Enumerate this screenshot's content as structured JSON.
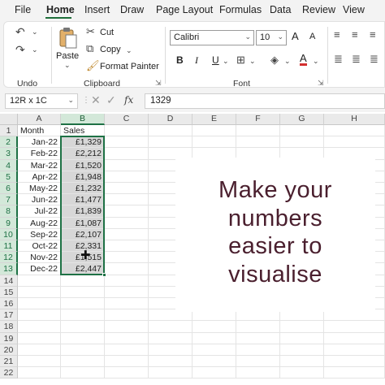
{
  "menu": {
    "items": [
      "File",
      "Home",
      "Insert",
      "Draw",
      "Page Layout",
      "Formulas",
      "Data",
      "Review",
      "View"
    ],
    "active": "Home"
  },
  "ribbon": {
    "undo_group_label": "Undo",
    "clipboard": {
      "paste_label": "Paste",
      "cut_label": "Cut",
      "copy_label": "Copy",
      "format_painter_label": "Format Painter",
      "group_label": "Clipboard"
    },
    "font": {
      "name": "Calibri",
      "size": "10",
      "group_label": "Font",
      "bold": "B",
      "italic": "I",
      "underline": "U",
      "grow": "A",
      "shrink": "A",
      "font_color_glyph": "A"
    }
  },
  "formula_bar": {
    "name_box": "12R x 1C",
    "fx": "fx",
    "value": "1329"
  },
  "grid": {
    "columns": [
      "A",
      "B",
      "C",
      "D",
      "E",
      "F",
      "G",
      "H"
    ],
    "rows": [
      "1",
      "2",
      "3",
      "4",
      "5",
      "6",
      "7",
      "8",
      "9",
      "10",
      "11",
      "12",
      "13",
      "14",
      "15",
      "16",
      "17",
      "18",
      "19",
      "20",
      "21",
      "22"
    ],
    "header": [
      "Month",
      "Sales"
    ],
    "data": [
      [
        "Jan-22",
        "£1,329"
      ],
      [
        "Feb-22",
        "£2,212"
      ],
      [
        "Mar-22",
        "£1,520"
      ],
      [
        "Apr-22",
        "£1,948"
      ],
      [
        "May-22",
        "£1,232"
      ],
      [
        "Jun-22",
        "£1,477"
      ],
      [
        "Jul-22",
        "£1,839"
      ],
      [
        "Aug-22",
        "£1,087"
      ],
      [
        "Sep-22",
        "£2,107"
      ],
      [
        "Oct-22",
        "£2,331"
      ],
      [
        "Nov-22",
        "£1,515"
      ],
      [
        "Dec-22",
        "£2,447"
      ]
    ]
  },
  "overlay": {
    "lines": [
      "Make your",
      "numbers",
      "easier to",
      "visualise"
    ]
  },
  "colors": {
    "accent_green": "#1e7145",
    "overlay_text": "#4a1f2e",
    "selection_fill": "#d7d7d7"
  }
}
